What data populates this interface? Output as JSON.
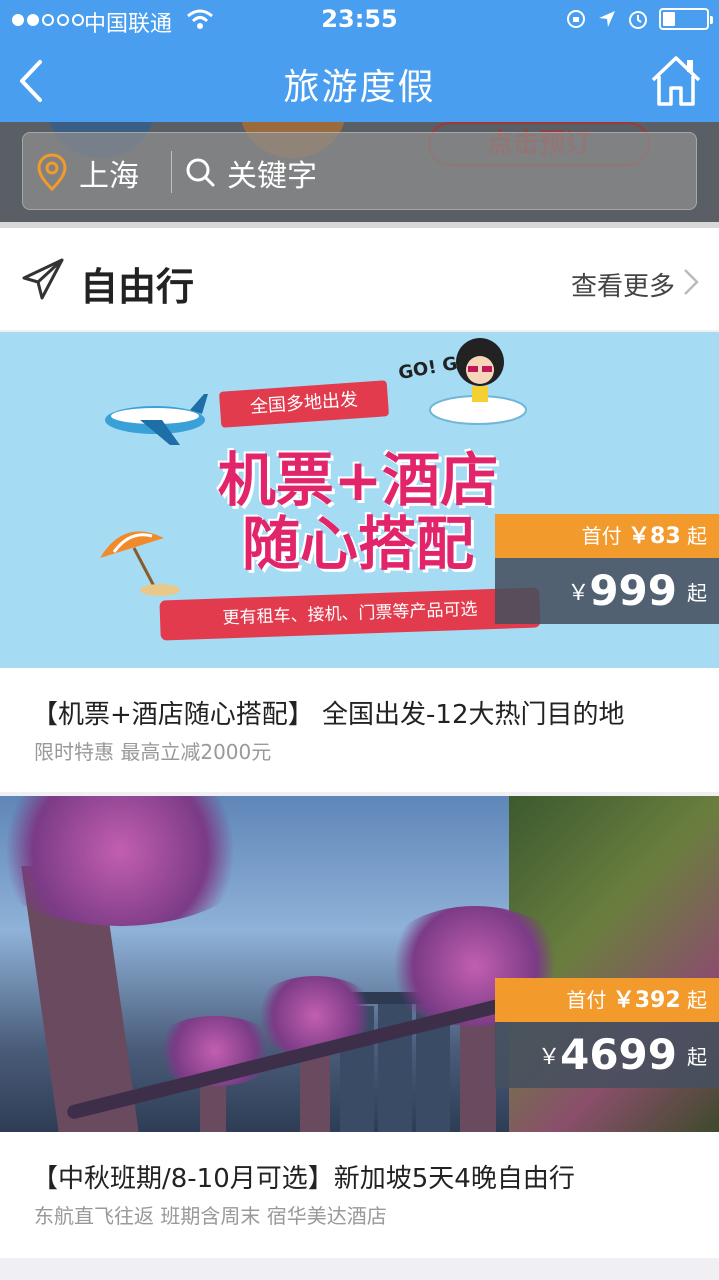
{
  "status_bar": {
    "carrier": "中国联通",
    "time": "23:55"
  },
  "nav": {
    "title": "旅游度假",
    "icons": [
      "back-icon",
      "home-icon"
    ]
  },
  "search": {
    "location": "上海",
    "keyword_placeholder": "关键字",
    "promo_button": "点击预订"
  },
  "section": {
    "title": "自由行",
    "more_label": "查看更多"
  },
  "ad_art": {
    "ribbon": "全国多地出发",
    "headline_line1": "机票+酒店",
    "headline_line2": "随心搭配",
    "footer": "更有租车、接机、门票等产品可选",
    "go": "GO! GO!"
  },
  "products": [
    {
      "title": "【机票+酒店随心搭配】 全国出发-12大热门目的地",
      "subtitle": "限时特惠 最高立减2000元",
      "down_label": "首付",
      "down_payment": "￥83",
      "down_suffix": "起",
      "currency": "￥",
      "price": "999",
      "price_suffix": "起"
    },
    {
      "title": "【中秋班期/8-10月可选】新加坡5天4晚自由行",
      "subtitle": "东航直飞往返 班期含周末 宿华美达酒店",
      "down_label": "首付",
      "down_payment": "￥392",
      "down_suffix": "起",
      "currency": "￥",
      "price": "4699",
      "price_suffix": "起"
    }
  ],
  "colors": {
    "nav_bg": "#4a9ef0",
    "price_orange": "#f39a2d",
    "price_dark": "#46505f",
    "location_icon": "#f39a2d"
  }
}
